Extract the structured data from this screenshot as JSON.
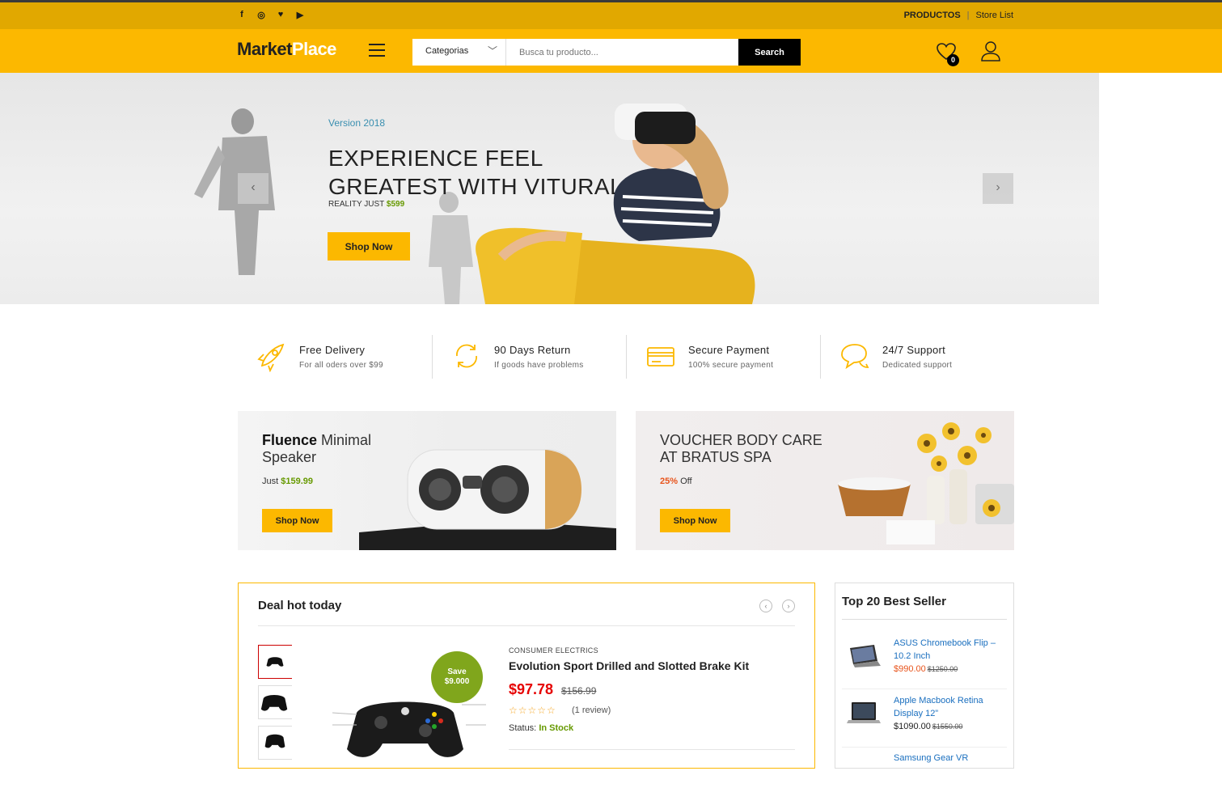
{
  "topbar": {
    "social": [
      "facebook-icon",
      "instagram-icon",
      "twitter-icon",
      "youtube-icon"
    ],
    "links": [
      "PRODUCTOS",
      "Store List"
    ]
  },
  "header": {
    "logo_market": "Market",
    "logo_place": "Place",
    "category_label": "Categorias",
    "search_placeholder": "Busca tu producto...",
    "search_button": "Search",
    "wishlist_count": "0",
    "accent": "#fcb800"
  },
  "hero": {
    "version": "Version 2018",
    "title": "EXPERIENCE FEEL GREATEST WITH VITURAL",
    "subtitle_prefix": "REALITY JUST",
    "price": "$599",
    "button": "Shop Now",
    "prev": "‹",
    "next": "›"
  },
  "features": [
    {
      "title": "Free Delivery",
      "sub": "For all oders over $99",
      "icon": "rocket-icon"
    },
    {
      "title": "90 Days Return",
      "sub": "If goods have problems",
      "icon": "refresh-icon"
    },
    {
      "title": "Secure Payment",
      "sub": "100% secure payment",
      "icon": "credit-card-icon"
    },
    {
      "title": "24/7 Support",
      "sub": "Dedicated support",
      "icon": "chat-icon"
    }
  ],
  "promos": [
    {
      "title_bold": "Fluence",
      "title_rest": " Minimal",
      "title_line2": "Speaker",
      "sub_prefix": "Just",
      "sub_value": "$159.99",
      "button": "Shop Now"
    },
    {
      "title_line1": "VOUCHER BODY CARE",
      "title_line2": "AT BRATUS SPA",
      "sub_value": "25%",
      "sub_suffix": "Off",
      "button": "Shop Now"
    }
  ],
  "deal": {
    "title": "Deal hot today",
    "save_label": "Save",
    "save_value": "$9.000",
    "category": "CONSUMER ELECTRICS",
    "name": "Evolution Sport Drilled and Slotted Brake Kit",
    "price": "$97.78",
    "old_price": "$156.99",
    "stars": "☆☆☆☆☆",
    "reviews": "(1 review)",
    "status_label": "Status:",
    "status_value": "In Stock"
  },
  "bestseller": {
    "title": "Top 20 Best Seller",
    "items": [
      {
        "name": "ASUS Chromebook Flip – 10.2 Inch",
        "price": "$990.00",
        "old": "$1250.00"
      },
      {
        "name": "Apple Macbook Retina Display 12”",
        "price": "$1090.00",
        "old": "$1550.00"
      },
      {
        "name": "Samsung Gear VR",
        "price": "",
        "old": ""
      }
    ]
  }
}
